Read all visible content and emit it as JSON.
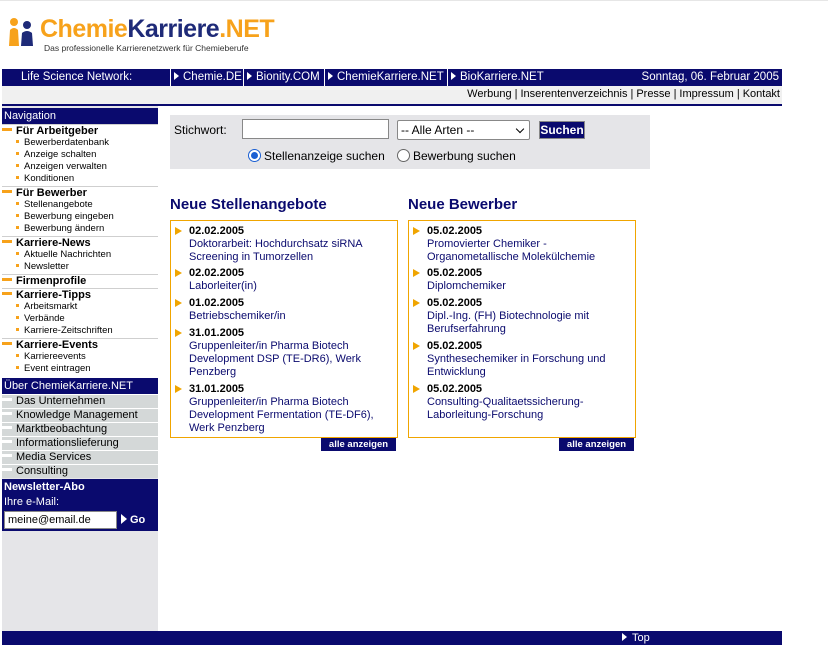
{
  "logo": {
    "part1": "Chemie",
    "part2": "Karriere",
    "part3": ".NET",
    "tagline": "Das professionelle Karrierenetzwerk für Chemieberufe"
  },
  "network": {
    "label": "Life Science Network:",
    "links": [
      "Chemie.DE",
      "Bionity.COM",
      "ChemieKarriere.NET",
      "BioKarriere.NET"
    ],
    "date": "Sonntag, 06. Februar 2005"
  },
  "util_links": [
    "Werbung",
    "Inserentenverzeichnis",
    "Presse",
    "Impressum",
    "Kontakt"
  ],
  "nav": {
    "title": "Navigation",
    "sections": [
      {
        "label": "Für Arbeitgeber",
        "items": [
          "Bewerberdatenbank",
          "Anzeige schalten",
          "Anzeigen verwalten",
          "Konditionen"
        ]
      },
      {
        "label": "Für Bewerber",
        "items": [
          "Stellenangebote",
          "Bewerbung eingeben",
          "Bewerbung ändern"
        ]
      },
      {
        "label": "Karriere-News",
        "items": [
          "Aktuelle Nachrichten",
          "Newsletter"
        ]
      },
      {
        "label": "Firmenprofile",
        "items": []
      },
      {
        "label": "Karriere-Tipps",
        "items": [
          "Arbeitsmarkt",
          "Verbände",
          "Karriere-Zeitschriften"
        ]
      },
      {
        "label": "Karriere-Events",
        "items": [
          "Karriereevents",
          "Event eintragen"
        ]
      }
    ]
  },
  "about": {
    "title": "Über ChemieKarriere.NET",
    "items": [
      "Das Unternehmen",
      "Knowledge Management",
      "Marktbeobachtung",
      "Informationslieferung",
      "Media Services",
      "Consulting"
    ]
  },
  "newsletter": {
    "title": "Newsletter-Abo",
    "label": "Ihre e-Mail:",
    "value": "meine@email.de",
    "go": "Go"
  },
  "search": {
    "label": "Stichwort:",
    "keyword": "",
    "select_value": "-- Alle Arten --",
    "button": "Suchen",
    "radio1": "Stellenanzeige suchen",
    "radio2": "Bewerbung suchen",
    "selected": "radio1"
  },
  "jobs": {
    "title": "Neue Stellenangebote",
    "button": "alle anzeigen",
    "entries": [
      {
        "date": "02.02.2005",
        "text": "Doktorarbeit: Hochdurchsatz siRNA Screening in Tumorzellen"
      },
      {
        "date": "02.02.2005",
        "text": "Laborleiter(in)"
      },
      {
        "date": "01.02.2005",
        "text": "Betriebschemiker/in"
      },
      {
        "date": "31.01.2005",
        "text": "Gruppenleiter/in Pharma Biotech Development DSP (TE-DR6), Werk Penzberg"
      },
      {
        "date": "31.01.2005",
        "text": "Gruppenleiter/in Pharma Biotech Development Fermentation (TE-DF6), Werk Penzberg"
      }
    ]
  },
  "applicants": {
    "title": "Neue Bewerber",
    "button": "alle anzeigen",
    "entries": [
      {
        "date": "05.02.2005",
        "text": "Promovierter Chemiker - Organometallische Molekülchemie"
      },
      {
        "date": "05.02.2005",
        "text": "Diplomchemiker"
      },
      {
        "date": "05.02.2005",
        "text": "Dipl.-Ing. (FH) Biotechnologie mit Berufserfahrung"
      },
      {
        "date": "05.02.2005",
        "text": "Synthesechemiker in Forschung und Entwicklung"
      },
      {
        "date": "05.02.2005",
        "text": "Consulting-Qualitaetssicherung-Laborleitung-Forschung"
      }
    ]
  },
  "footer": {
    "top": "Top"
  },
  "colors": {
    "navy": "#0a0a6e",
    "orange": "#f7a21b",
    "sidebar": "#e5e5e8"
  }
}
